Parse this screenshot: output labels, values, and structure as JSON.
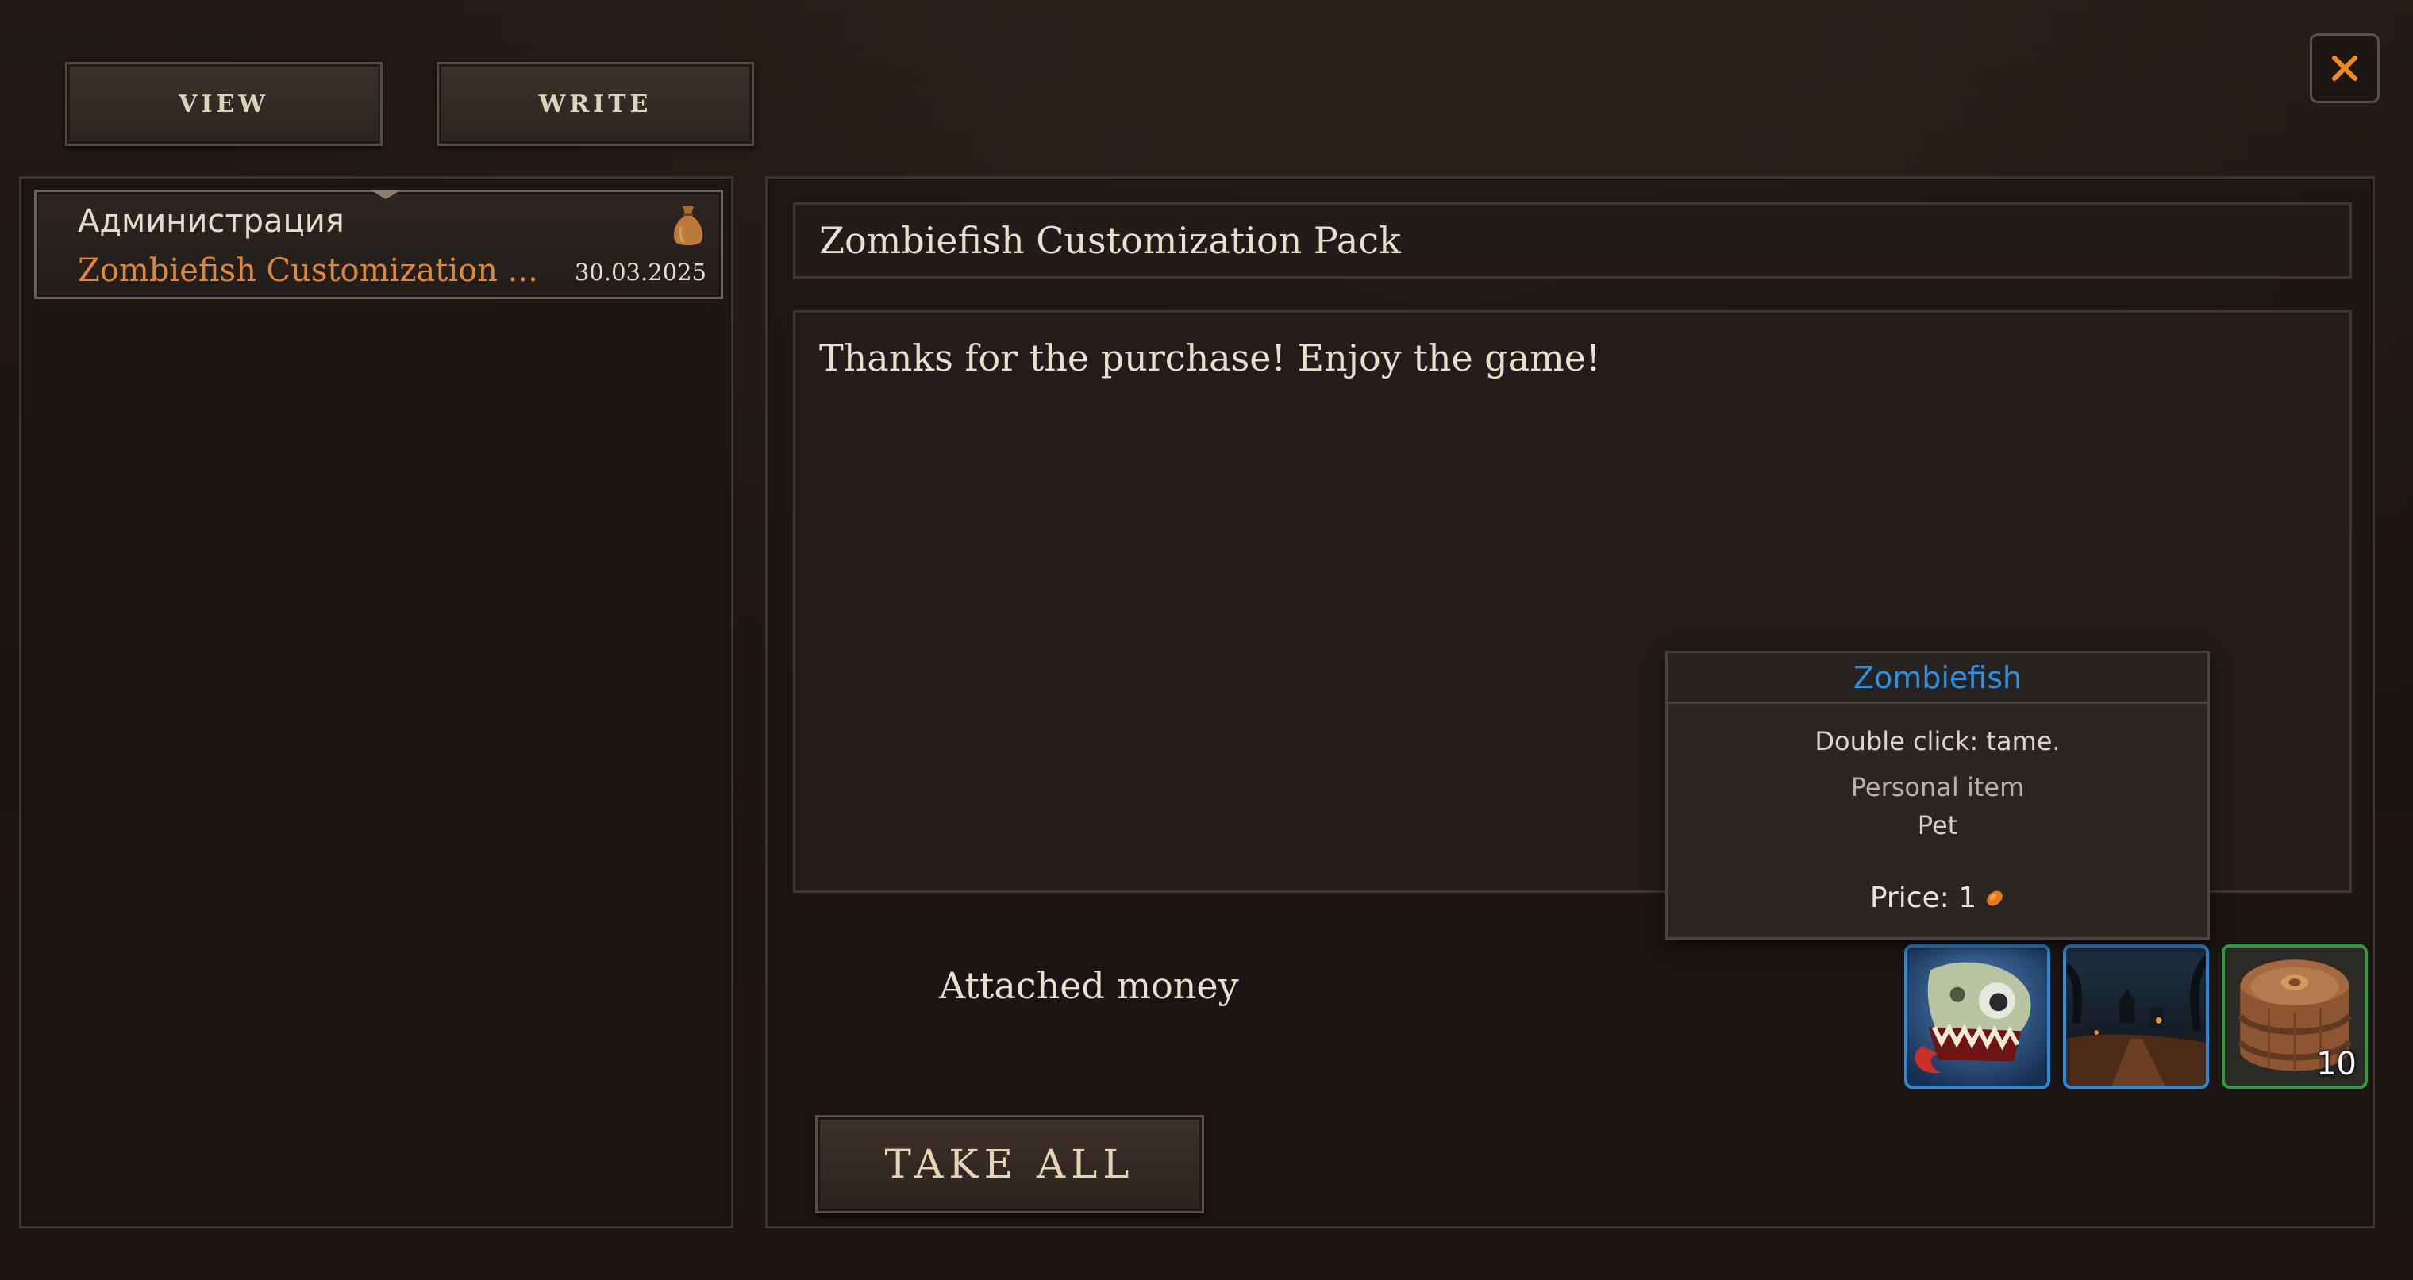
{
  "tabs": {
    "view_label": "VIEW",
    "write_label": "WRITE"
  },
  "close": {
    "icon": "close-icon",
    "color": "#f08a1e"
  },
  "mail_list": {
    "items": [
      {
        "sender": "Администрация",
        "subject": "Zombiefish Customization ...",
        "date": "30.03.2025",
        "icon": "money-bag-icon"
      }
    ]
  },
  "mail": {
    "subject": "Zombiefish Customization Pack",
    "body": "Thanks for the purchase! Enjoy the game!",
    "attached_money_label": "Attached money",
    "take_all_label": "TAKE ALL",
    "attachments": [
      {
        "icon": "zombiefish-pet-icon",
        "rarity_color": "#2a8ad6"
      },
      {
        "icon": "graveyard-scene-icon",
        "rarity_color": "#2a8ad6"
      },
      {
        "icon": "wooden-barrel-icon",
        "rarity_color": "#2f9a3e",
        "count": "10"
      }
    ]
  },
  "tooltip": {
    "title": "Zombiefish",
    "title_color": "#2f8fe0",
    "action": "Double click: tame.",
    "personal": "Personal item",
    "type": "Pet",
    "price_text": "Price: 1",
    "price_icon": "coin-icon"
  }
}
